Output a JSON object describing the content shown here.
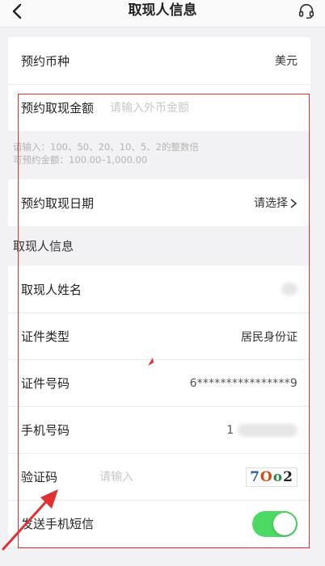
{
  "nav": {
    "title": "取现人信息",
    "back_icon": "chevron-left-icon",
    "service_icon": "headset-icon"
  },
  "currency": {
    "label": "预约币种",
    "value": "美元"
  },
  "amount": {
    "label": "预约取现金额",
    "placeholder": "请输入外币金额",
    "hint_multiple": "请输入：100、50、20、10、5、2的整数倍",
    "hint_range": "可预约金额：100.00–1,000.00"
  },
  "date": {
    "label": "预约取现日期",
    "value": "请选择"
  },
  "section_title": "取现人信息",
  "person": {
    "name_label": "取现人姓名",
    "id_type_label": "证件类型",
    "id_type_value": "居民身份证",
    "id_number_label": "证件号码",
    "id_number_value": "6****************9",
    "phone_label": "手机号码",
    "phone_value_prefix": "1",
    "verify_label": "验证码",
    "verify_placeholder": "请输入",
    "captcha_text": "7Oo2",
    "sms_label": "发送手机短信",
    "sms_enabled": true
  },
  "colors": {
    "accent_toggle": "#4cd964",
    "annotation_red": "#e03131",
    "background": "#f2f2f4"
  }
}
